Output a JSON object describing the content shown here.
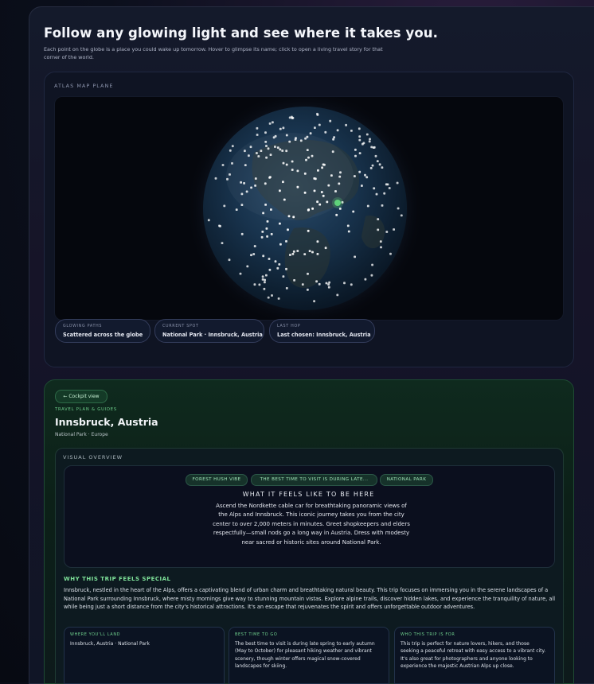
{
  "hero": {
    "title": "Follow any glowing light and see where it takes you.",
    "subtitle": "Each point on the globe is a place you could wake up tomorrow. Hover to glimpse its name; click to open a living travel story for that corner of the world."
  },
  "atlas": {
    "label": "ATLAS MAP PLANE",
    "pills": [
      {
        "key": "GLOWING PATHS",
        "value": "Scattered across the globe"
      },
      {
        "key": "CURRENT SPOT",
        "value": "National Park · Innsbruck, Austria"
      },
      {
        "key": "LAST HOP",
        "value": "Last chosen: Innsbruck, Austria"
      }
    ]
  },
  "destination": {
    "back_label": "← Cockpit view",
    "eyebrow": "TRAVEL PLAN & GUIDES",
    "title": "Innsbruck, Austria",
    "meta": "National Park · Europe",
    "overview_label": "VISUAL OVERVIEW",
    "chips": [
      "FOREST HUSH VIBE",
      "THE BEST TIME TO VISIT IS DURING LATE...",
      "NATIONAL PARK"
    ],
    "feel_heading": "WHAT IT FEELS LIKE TO BE HERE",
    "feel_text": "Ascend the Nordkette cable car for breathtaking panoramic views of the Alps and Innsbruck. This iconic journey takes you from the city center to over 2,000 meters in minutes. Greet shopkeepers and elders respectfully—small nods go a long way in Austria. Dress with modesty near sacred or historic sites around National Park.",
    "why_heading": "WHY THIS TRIP FEELS SPECIAL",
    "why_text": "Innsbruck, nestled in the heart of the Alps, offers a captivating blend of urban charm and breathtaking natural beauty. This trip focuses on immersing you in the serene landscapes of a National Park surrounding Innsbruck, where misty mornings give way to stunning mountain vistas. Explore alpine trails, discover hidden lakes, and experience the tranquility of nature, all while being just a short distance from the city's historical attractions. It's an escape that rejuvenates the spirit and offers unforgettable outdoor adventures.",
    "cards": [
      {
        "key": "WHERE YOU'LL LAND",
        "value": "Innsbruck, Austria · National Park"
      },
      {
        "key": "BEST TIME TO GO",
        "value": "The best time to visit is during late spring to early autumn (May to October) for pleasant hiking weather and vibrant scenery, though winter offers magical snow-covered landscapes for skiing."
      },
      {
        "key": "WHO THIS TRIP IS FOR",
        "value": "This trip is perfect for nature lovers, hikers, and those seeking a peaceful retreat with easy access to a vibrant city. It's also great for photographers and anyone looking to experience the majestic Austrian Alps up close."
      }
    ]
  },
  "colors": {
    "accent_green": "#6fd08d",
    "selected_marker": "#5fd27a",
    "marker": "#ffffff",
    "globe_ocean": "#143049"
  }
}
